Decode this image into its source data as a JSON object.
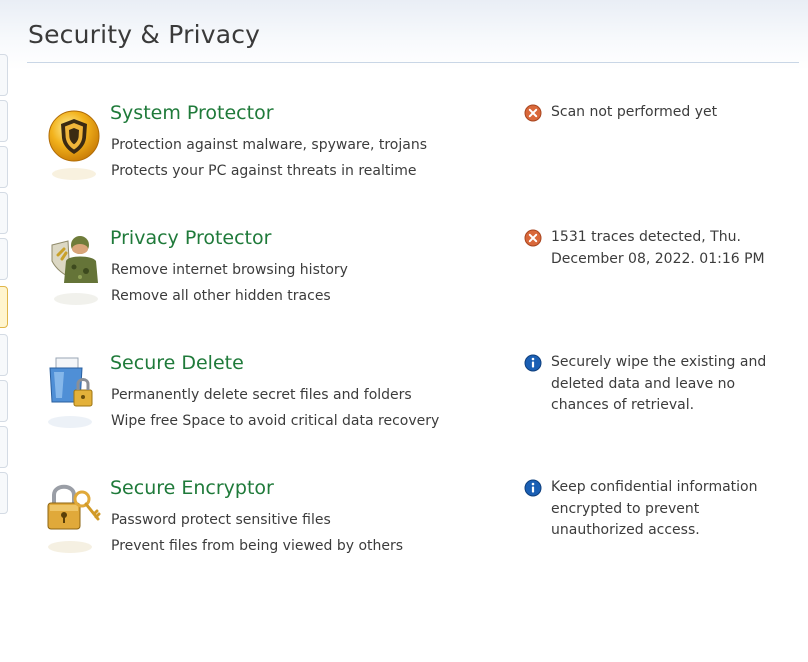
{
  "header": {
    "title": "Security & Privacy"
  },
  "features": [
    {
      "title": "System Protector",
      "line1": "Protection against malware, spyware, trojans",
      "line2": "Protects your PC against threats in realtime",
      "icon": "shield-icon",
      "status_icon": "error-icon",
      "status_text": "Scan not performed yet"
    },
    {
      "title": "Privacy Protector",
      "line1": "Remove internet browsing history",
      "line2": "Remove all other hidden traces",
      "icon": "privacy-guard-icon",
      "status_icon": "error-icon",
      "status_text": "1531 traces detected, Thu. December 08, 2022. 01:16 PM"
    },
    {
      "title": "Secure Delete",
      "line1": "Permanently delete secret files and folders",
      "line2": "Wipe free Space to avoid critical data recovery",
      "icon": "shredder-lock-icon",
      "status_icon": "info-icon",
      "status_text": "Securely wipe the existing and deleted data and leave no chances of retrieval."
    },
    {
      "title": "Secure Encryptor",
      "line1": "Password protect sensitive files",
      "line2": "Prevent files from being viewed by others",
      "icon": "padlock-key-icon",
      "status_icon": "info-icon",
      "status_text": "Keep confidential information encrypted to prevent unauthorized access."
    }
  ],
  "colors": {
    "title_green": "#1f7a3a",
    "error_orange": "#d9683a",
    "info_blue": "#1a5fb4"
  }
}
